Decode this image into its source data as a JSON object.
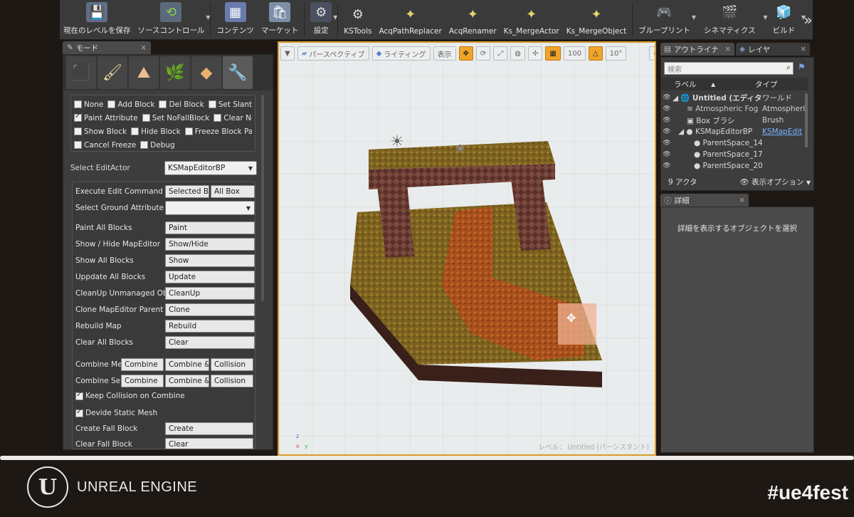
{
  "toolbar": {
    "items": [
      {
        "label": "現在のレベルを保存",
        "icon": "save-icon"
      },
      {
        "label": "ソースコントロール",
        "icon": "source-control-icon"
      },
      {
        "label": "コンテンツ",
        "icon": "content-icon"
      },
      {
        "label": "マーケット",
        "icon": "marketplace-icon"
      },
      {
        "label": "設定",
        "icon": "settings-icon"
      },
      {
        "label": "KSTools",
        "icon": "gear-icon"
      },
      {
        "label": "AcqPathReplacer",
        "icon": "wand-icon"
      },
      {
        "label": "AcqRenamer",
        "icon": "wand-icon"
      },
      {
        "label": "Ks_MergeActor",
        "icon": "wand-icon"
      },
      {
        "label": "Ks_MergeObject",
        "icon": "wand-icon"
      },
      {
        "label": "ブループリント",
        "icon": "blueprint-icon"
      },
      {
        "label": "シネマティクス",
        "icon": "cinematics-icon"
      },
      {
        "label": "ビルド",
        "icon": "build-icon"
      }
    ],
    "more": "»"
  },
  "modes": {
    "tab_label": "モード",
    "tab_close": "×",
    "checkboxes": [
      [
        {
          "label": "None",
          "checked": false
        },
        {
          "label": "Add Block",
          "checked": false
        },
        {
          "label": "Del Block",
          "checked": false
        },
        {
          "label": "Set Slant",
          "checked": false
        },
        {
          "label": "S",
          "checked": false
        }
      ],
      [
        {
          "label": "Paint Attribute",
          "checked": true
        },
        {
          "label": "Set NoFallBlock",
          "checked": false
        },
        {
          "label": "Clear NoFallBl",
          "checked": false
        }
      ],
      [
        {
          "label": "Show Block",
          "checked": false
        },
        {
          "label": "Hide Block",
          "checked": false
        },
        {
          "label": "Freeze Block Pattern",
          "checked": false
        }
      ],
      [
        {
          "label": "Cancel Freeze",
          "checked": false
        },
        {
          "label": "Debug",
          "checked": false
        }
      ]
    ],
    "select_edit_actor_label": "Select EditActor",
    "select_edit_actor_value": "KSMapEditorBP",
    "commands": [
      {
        "label": "Execute Edit Command",
        "buttons": [
          "Selected Bo",
          "All Box"
        ]
      },
      {
        "label": "Select Ground Attribute",
        "select": ""
      },
      {
        "label": "Paint All Blocks",
        "buttons": [
          "Paint"
        ]
      },
      {
        "label": "Show / Hide MapEditor",
        "buttons": [
          "Show/Hide"
        ]
      },
      {
        "label": "Show All Blocks",
        "buttons": [
          "Show"
        ]
      },
      {
        "label": "Uppdate All Blocks",
        "buttons": [
          "Update"
        ]
      },
      {
        "label": "CleanUp Unmanaged Object",
        "buttons": [
          "CleanUp"
        ]
      },
      {
        "label": "Clone MapEditor Parent",
        "buttons": [
          "Clone"
        ]
      },
      {
        "label": "Rebuild Map",
        "buttons": [
          "Rebuild"
        ]
      },
      {
        "label": "Clear All Blocks",
        "buttons": [
          "Clear"
        ]
      },
      {
        "label": "Combine Mesh",
        "buttons": [
          "Combine",
          "Combine & I",
          "Collision"
        ]
      },
      {
        "label": "Combine Selec",
        "buttons": [
          "Combine",
          "Combine & I",
          "Collision"
        ]
      },
      {
        "label": "Keep Collision on Combine",
        "checkbox": true
      },
      {
        "label": "Devide Static Mesh",
        "checkbox": true
      },
      {
        "label": "Create Fall Block",
        "buttons": [
          "Create"
        ]
      },
      {
        "label": "Clear Fall Block",
        "buttons": [
          "Clear"
        ]
      }
    ]
  },
  "viewport": {
    "perspective": "パースペクティブ",
    "lighting": "ライティング",
    "show": "表示",
    "grid_snap": "100",
    "rotation_snap": "10°",
    "status_prefix": "レベル：",
    "status_level": "Untitled (パーシスタント)",
    "axis_z": "z",
    "axis_x": "x",
    "axis_y": "y"
  },
  "outliner": {
    "tab_label": "アウトライナ",
    "layers_tab": "レイヤ",
    "search_placeholder": "検索",
    "col_label": "ラベル",
    "col_type": "タイプ",
    "rows": [
      {
        "name": "Untitled (エディタ)",
        "type": "ワールド",
        "link": false
      },
      {
        "name": "Atmospheric Fog",
        "type": "Atmospheri",
        "link": false
      },
      {
        "name": "Box ブラシ",
        "type": "Brush",
        "link": false
      },
      {
        "name": "KSMapEditorBP",
        "type": "KSMapEdit",
        "link": true
      },
      {
        "name": "ParentSpace_14!",
        "type": "",
        "link": false
      },
      {
        "name": "ParentSpace_17:",
        "type": "",
        "link": false
      },
      {
        "name": "ParentSpace_20",
        "type": "",
        "link": false
      }
    ],
    "actor_count": "9 アクタ",
    "view_options": "表示オプション"
  },
  "details": {
    "tab_label": "詳細",
    "message": "詳細を表示するオブジェクトを選択"
  },
  "banner": {
    "brand": "UNREAL ENGINE",
    "hashtag": "#ue4fest"
  },
  "colors": {
    "viewport_border": "#d89a2a",
    "grass": "#8a6a22",
    "dirt_path": "#b0541e",
    "rock": "#6b3a33"
  }
}
